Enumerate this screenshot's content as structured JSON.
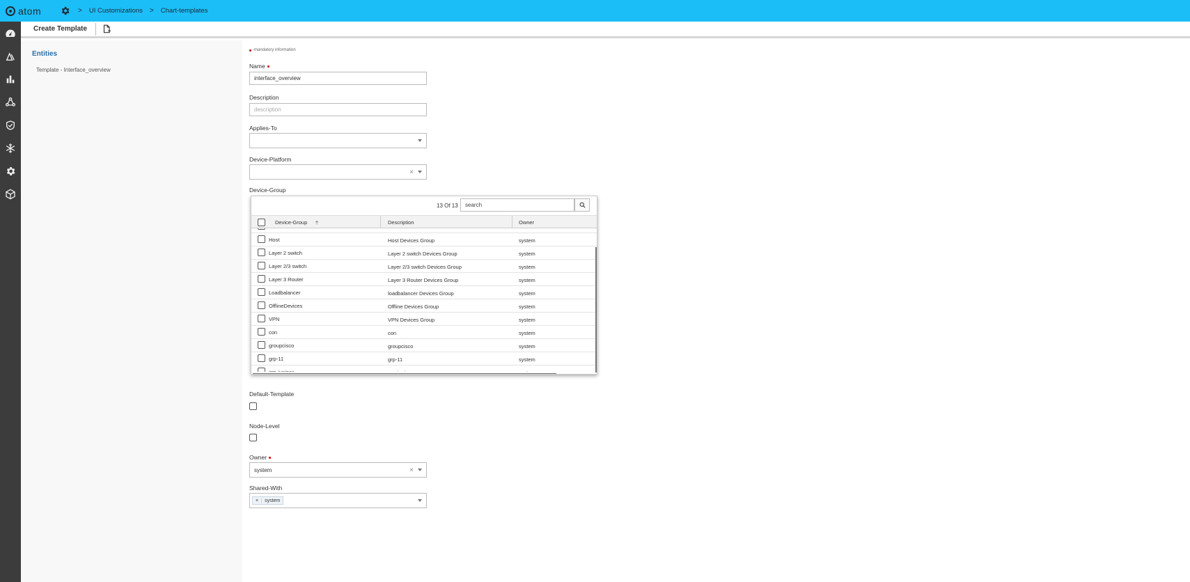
{
  "app": {
    "brand": "atom",
    "breadcrumb": [
      "UI Customizations",
      "Chart-templates"
    ]
  },
  "toolbar": {
    "title": "Create Template"
  },
  "entities": {
    "title": "Entities",
    "items": [
      "Template - Interface_overview"
    ]
  },
  "form": {
    "mandatory_note": "-mandatory information",
    "name": {
      "label": "Name",
      "value": "interface_overview"
    },
    "description": {
      "label": "Description",
      "placeholder": "description"
    },
    "applies_to": {
      "label": "Applies-To",
      "value": ""
    },
    "device_platform": {
      "label": "Device-Platform",
      "value": "",
      "clear": "×"
    },
    "device_group": {
      "label": "Device-Group",
      "count": "13 Of 13",
      "search_value": "search",
      "columns": [
        "Device-Group",
        "Description",
        "Owner"
      ],
      "rows": [
        {
          "name": "",
          "description": "",
          "owner": ""
        },
        {
          "name": "Host",
          "description": "Host Devices Group",
          "owner": "system"
        },
        {
          "name": "Layer 2 switch",
          "description": "Layer 2 switch Devices Group",
          "owner": "system"
        },
        {
          "name": "Layer 2/3 switch",
          "description": "Layer 2/3 switch Devices Group",
          "owner": "system"
        },
        {
          "name": "Layer 3 Router",
          "description": "Layer 3 Router Devices Group",
          "owner": "system"
        },
        {
          "name": "Loadbalancer",
          "description": "loadbalancer Devices Group",
          "owner": "system"
        },
        {
          "name": "OfflineDevices",
          "description": "Offline Devices Group",
          "owner": "system"
        },
        {
          "name": "VPN",
          "description": "VPN Devices Group",
          "owner": "system"
        },
        {
          "name": "con",
          "description": "con",
          "owner": "system"
        },
        {
          "name": "groupcisco",
          "description": "groupcisco",
          "owner": "system"
        },
        {
          "name": "grp-11",
          "description": "grp-11",
          "owner": "system"
        },
        {
          "name": "grp-juniper",
          "description": "grp-juniper",
          "owner": "system"
        }
      ]
    },
    "default_template": {
      "label": "Default-Template"
    },
    "node_level": {
      "label": "Node-Level"
    },
    "owner": {
      "label": "Owner",
      "value": "system",
      "clear": "×"
    },
    "shared_with": {
      "label": "Shared-With",
      "tag": "system",
      "tag_x": "×"
    }
  }
}
